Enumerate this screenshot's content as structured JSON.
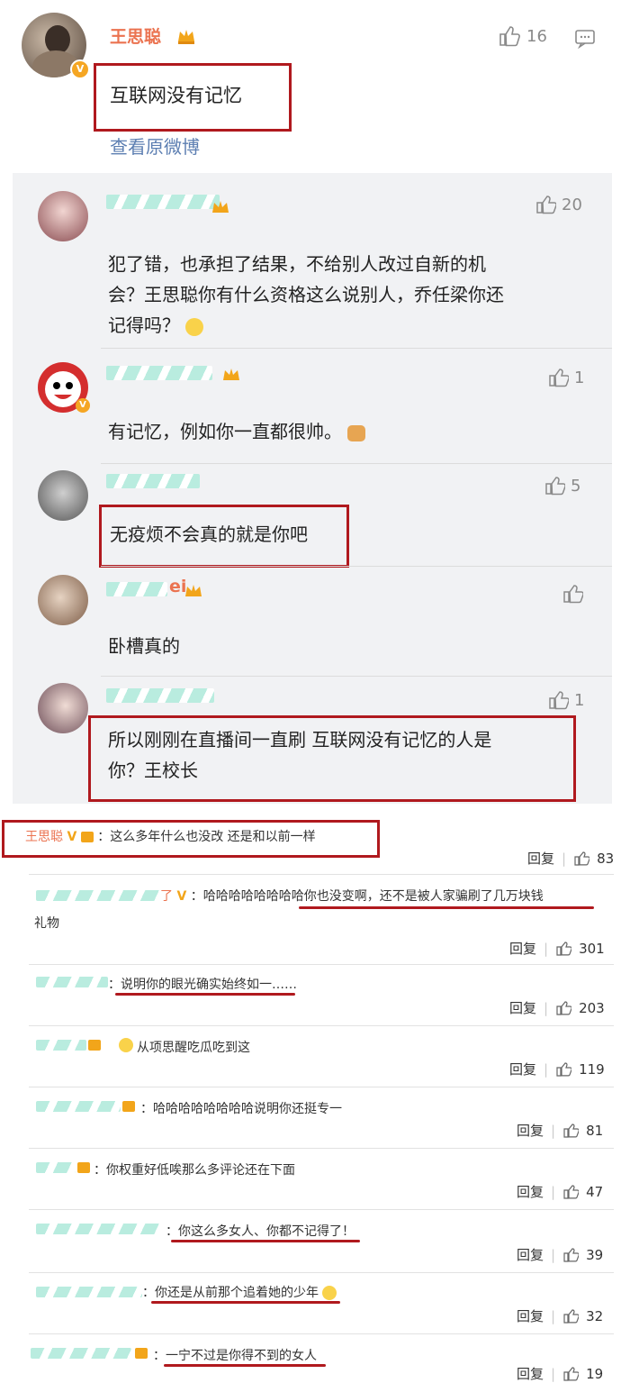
{
  "main_post": {
    "username": "王思聪",
    "likes": "16",
    "text": "互联网没有记忆",
    "view_original": "查看原微博"
  },
  "replies": [
    {
      "name_visible": "",
      "likes": "20",
      "lines": [
        "犯了错，也承担了结果，不给别人改过自新的机",
        "会？王思聪你有什么资格这么说别人，乔任梁你还",
        "记得吗？"
      ]
    },
    {
      "name_visible": "",
      "likes": "1",
      "lines": [
        "有记忆，例如你一直都很帅。"
      ]
    },
    {
      "name_visible": "",
      "likes": "5",
      "lines": [
        "无疫烦不会真的就是你吧"
      ]
    },
    {
      "name_visible": "ei",
      "likes": "",
      "lines": [
        "卧槽真的"
      ]
    },
    {
      "name_visible": "",
      "likes": "1",
      "lines": [
        "所以刚刚在直播间一直刷 互联网没有记忆的人是",
        "你？王校长"
      ]
    }
  ],
  "bottom": {
    "reply_label": "回复",
    "comments": [
      {
        "name": "王思聪",
        "vip": "V",
        "text": "：这么多年什么也没改 还是和以前一样",
        "likes": "83"
      },
      {
        "name_suffix": "了",
        "vip": "V",
        "text": "：哈哈哈哈哈哈哈哈你也没变啊，还不是被人家骗刷了几万块钱",
        "text2": "礼物",
        "likes": "301"
      },
      {
        "text": "：说明你的眼光确实始终如一……",
        "likes": "203"
      },
      {
        "text": "从项思醒吃瓜吃到这",
        "likes": "119"
      },
      {
        "text": "：哈哈哈哈哈哈哈哈说明你还挺专一",
        "likes": "81"
      },
      {
        "text": "：你权重好低唉那么多评论还在下面",
        "likes": "47"
      },
      {
        "text": "：你这么多女人、你都不记得了！",
        "likes": "39"
      },
      {
        "text": "：你还是从前那个追着她的少年",
        "likes": "32"
      },
      {
        "text": "：一宁不过是你得不到的女人",
        "likes": "19"
      }
    ]
  },
  "colors": {
    "accent_orange": "#eb7350",
    "highlight_red": "#b0191e",
    "link_blue": "#5d7fb2"
  }
}
